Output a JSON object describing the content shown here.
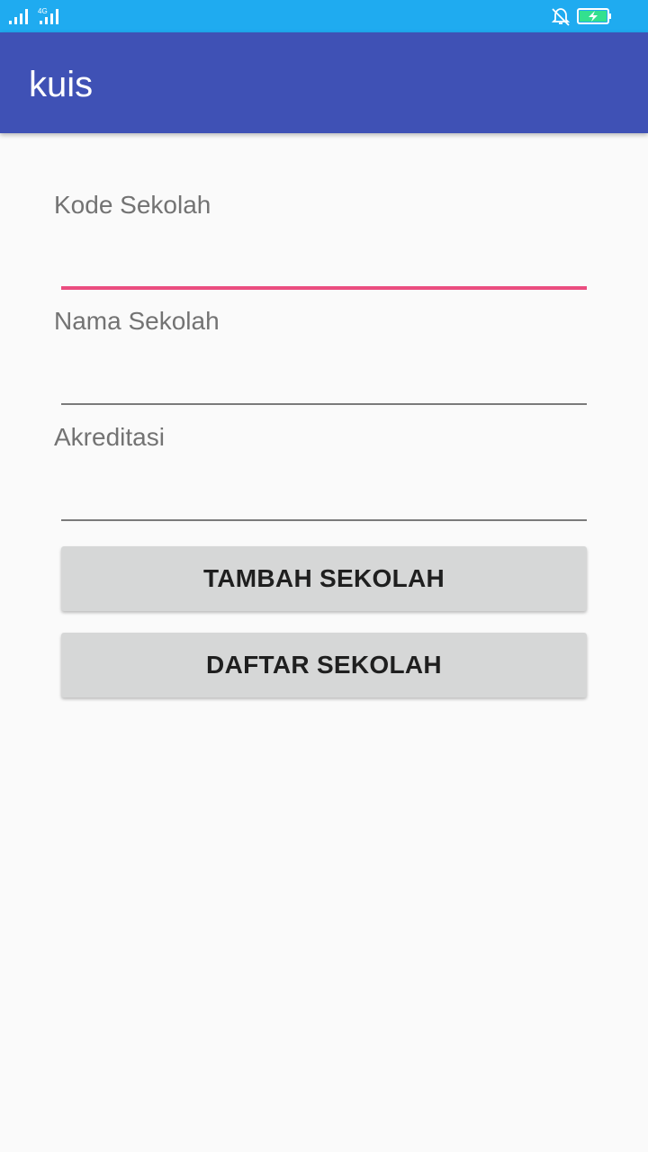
{
  "status_bar": {
    "network": "4G",
    "icons": [
      "signal-icon",
      "signal-4g-icon",
      "notifications-off-icon",
      "battery-charging-icon"
    ]
  },
  "app_bar": {
    "title": "kuis",
    "color": "#3f51b5"
  },
  "form": {
    "fields": [
      {
        "label": "Kode Sekolah",
        "value": ""
      },
      {
        "label": "Nama Sekolah",
        "value": ""
      },
      {
        "label": "Akreditasi",
        "value": ""
      }
    ],
    "accent": "#ea4d80"
  },
  "buttons": {
    "add": "TAMBAH SEKOLAH",
    "list": "DAFTAR SEKOLAH"
  }
}
